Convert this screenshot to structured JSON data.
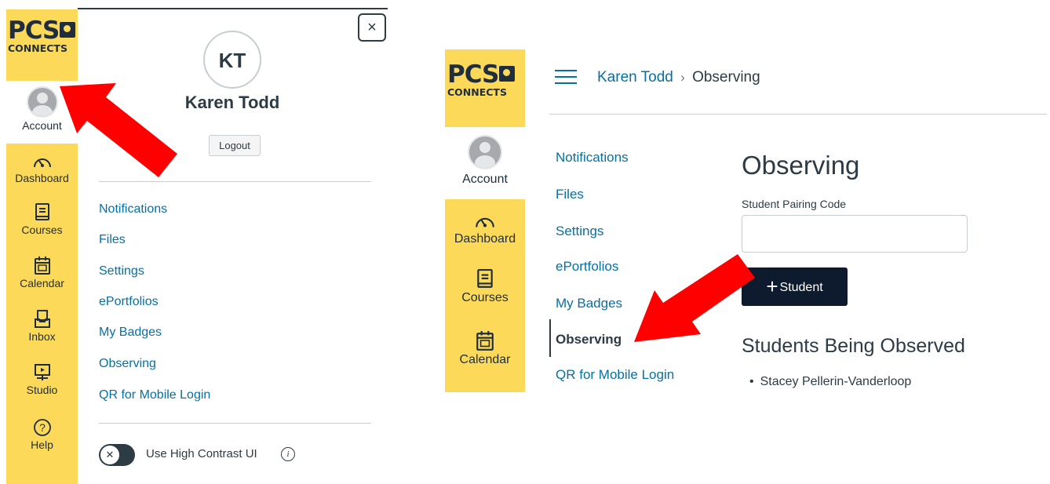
{
  "left_panel": {
    "logo_top": "PCS",
    "logo_bottom": "CONNECTS",
    "nav": {
      "account": "Account",
      "dashboard": "Dashboard",
      "courses": "Courses",
      "calendar": "Calendar",
      "inbox": "Inbox",
      "studio": "Studio",
      "help": "Help"
    },
    "tray": {
      "initials": "KT",
      "user_name": "Karen Todd",
      "logout_label": "Logout",
      "close_label": "×",
      "links": [
        "Notifications",
        "Files",
        "Settings",
        "ePortfolios",
        "My Badges",
        "Observing",
        "QR for Mobile Login"
      ],
      "toggle_label": "Use High Contrast UI",
      "info_glyph": "i"
    }
  },
  "right_panel": {
    "logo_top": "PCS",
    "logo_bottom": "CONNECTS",
    "nav": {
      "account": "Account",
      "dashboard": "Dashboard",
      "courses": "Courses",
      "calendar": "Calendar"
    },
    "breadcrumb": {
      "parent": "Karen Todd",
      "separator": "›",
      "current": "Observing"
    },
    "sidebar_links": [
      "Notifications",
      "Files",
      "Settings",
      "ePortfolios",
      "My Badges",
      "Observing",
      "QR for Mobile Login"
    ],
    "active_link": "Observing",
    "page_title": "Observing",
    "pairing_label": "Student Pairing Code",
    "pairing_value": "",
    "add_button_label": "Student",
    "observed_heading": "Students Being Observed",
    "observed_students": [
      "Stacey Pellerin-Vanderloop"
    ]
  },
  "colors": {
    "brand_yellow": "#fcd959",
    "link_blue": "#0770a3",
    "button_navy": "#0e1b2e",
    "arrow_red": "#ff0000"
  }
}
